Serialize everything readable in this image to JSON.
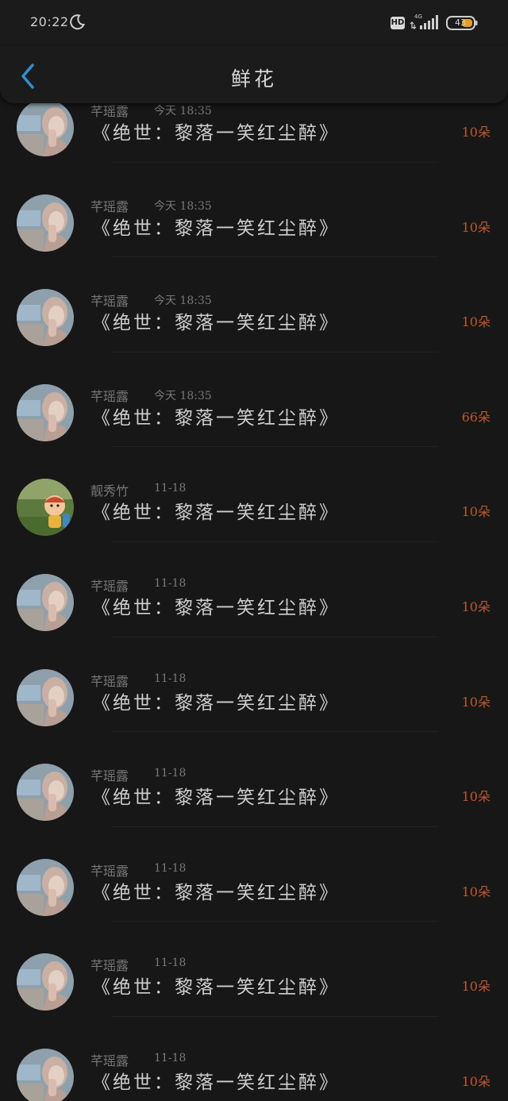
{
  "status_bar": {
    "time": "20:22",
    "hd": "HD",
    "network": "4G",
    "battery": "43",
    "moon_icon": "moon-icon",
    "signal_icon": "signal-icon",
    "battery_icon": "battery-icon",
    "accent_battery": "#e3a21a"
  },
  "nav": {
    "title": "鲜花",
    "back_icon": "chevron-left-icon",
    "back_color": "#2f8fd6"
  },
  "rows": [
    {
      "name": "芊瑶露",
      "time": "今天 18:35",
      "book": "《绝世：黎落一笑红尘醉》",
      "count": "10朵",
      "avatar": "girl"
    },
    {
      "name": "芊瑶露",
      "time": "今天 18:35",
      "book": "《绝世：黎落一笑红尘醉》",
      "count": "10朵",
      "avatar": "girl"
    },
    {
      "name": "芊瑶露",
      "time": "今天 18:35",
      "book": "《绝世：黎落一笑红尘醉》",
      "count": "10朵",
      "avatar": "girl"
    },
    {
      "name": "芊瑶露",
      "time": "今天 18:35",
      "book": "《绝世：黎落一笑红尘醉》",
      "count": "66朵",
      "avatar": "girl"
    },
    {
      "name": "靓秀竹",
      "time": "11-18",
      "book": "《绝世：黎落一笑红尘醉》",
      "count": "10朵",
      "avatar": "cartoon"
    },
    {
      "name": "芊瑶露",
      "time": "11-18",
      "book": "《绝世：黎落一笑红尘醉》",
      "count": "10朵",
      "avatar": "girl"
    },
    {
      "name": "芊瑶露",
      "time": "11-18",
      "book": "《绝世：黎落一笑红尘醉》",
      "count": "10朵",
      "avatar": "girl"
    },
    {
      "name": "芊瑶露",
      "time": "11-18",
      "book": "《绝世：黎落一笑红尘醉》",
      "count": "10朵",
      "avatar": "girl"
    },
    {
      "name": "芊瑶露",
      "time": "11-18",
      "book": "《绝世：黎落一笑红尘醉》",
      "count": "10朵",
      "avatar": "girl"
    },
    {
      "name": "芊瑶露",
      "time": "11-18",
      "book": "《绝世：黎落一笑红尘醉》",
      "count": "10朵",
      "avatar": "girl"
    },
    {
      "name": "芊瑶露",
      "time": "11-18",
      "book": "《绝世：黎落一笑红尘醉》",
      "count": "10朵",
      "avatar": "girl"
    }
  ],
  "colors": {
    "background": "#171717",
    "count_accent": "#c0582a",
    "primary_text": "#cfcfcf",
    "secondary_text": "#777777"
  }
}
